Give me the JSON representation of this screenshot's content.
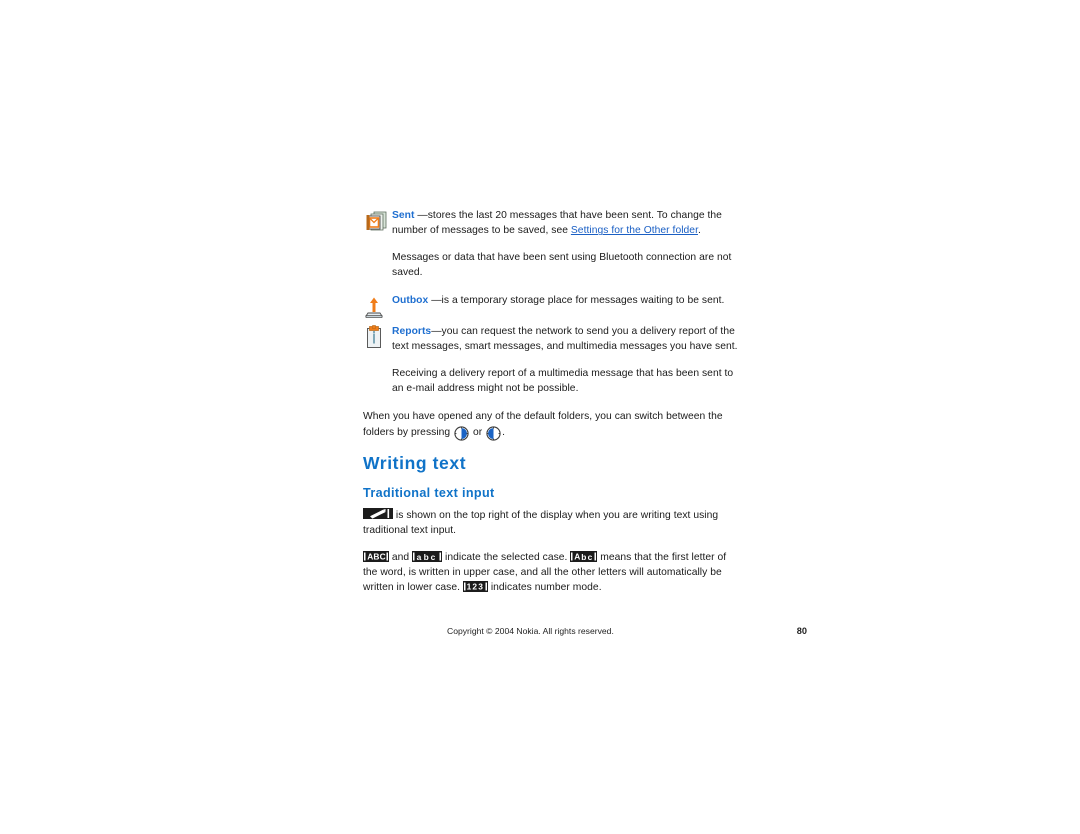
{
  "document": {
    "title": "Nokia user guide page 80",
    "page_number": "80",
    "footer_copyright": "Copyright © 2004 Nokia. All rights reserved."
  },
  "colors": {
    "heading_blue": "#1073c8",
    "term_blue": "#1f6fd0",
    "link_blue": "#1a5fc4",
    "icon_orange": "#f07d1a",
    "body_text": "#1a1a1a"
  },
  "sections": {
    "folders": {
      "items": [
        {
          "icon": "sent-folder-icon",
          "term": "Sent",
          "text_before_link": "—stores the last 20 messages that have been sent. To change the number of messages to be saved, see ",
          "link_text": "Settings for the Other folder",
          "text_after_link": "."
        },
        {
          "icon": "outbox-folder-icon",
          "term": "Outbox",
          "text_before_link": "—is a temporary storage place for messages waiting to be sent.",
          "link_text": "",
          "text_after_link": ""
        },
        {
          "icon": "reports-folder-icon",
          "term": "Reports",
          "text_before_link": "—you can request the network to send you a delivery report of the text messages, smart messages, and multimedia messages you have sent.",
          "link_text": "",
          "text_after_link": ""
        }
      ],
      "note_sent": "Messages or data that have been sent using Bluetooth connection are not saved.",
      "note_reports": "Receiving a delivery report of a multimedia message that has been sent to an e-mail address might not be possible.",
      "switch_paragraph_part1": "When you have opened any of the default folders, you can switch between the folders by pressing ",
      "switch_paragraph_or": " or ",
      "switch_paragraph_end": ".",
      "nav_key_right": "scroll-right-key-icon",
      "nav_key_left": "scroll-left-key-icon"
    },
    "writing_text": {
      "heading": "Writing text",
      "subheading": "Traditional text input",
      "para1_part1": " is shown on the top right of the display when you are writing text using traditional text input.",
      "pen_indicator": "traditional-input-pen-icon",
      "para2_part1": " and ",
      "para2_part2": " indicate the selected case. ",
      "para2_part3": " means that the first letter of the word, is written in upper case, and all the other letters will automatically be written in lower case. ",
      "para2_part4": " indicates number mode.",
      "indicator_abc_upper": "ABC",
      "indicator_abc_lower": "abc",
      "indicator_abc_mixed": "Abc",
      "indicator_number": "123"
    }
  }
}
